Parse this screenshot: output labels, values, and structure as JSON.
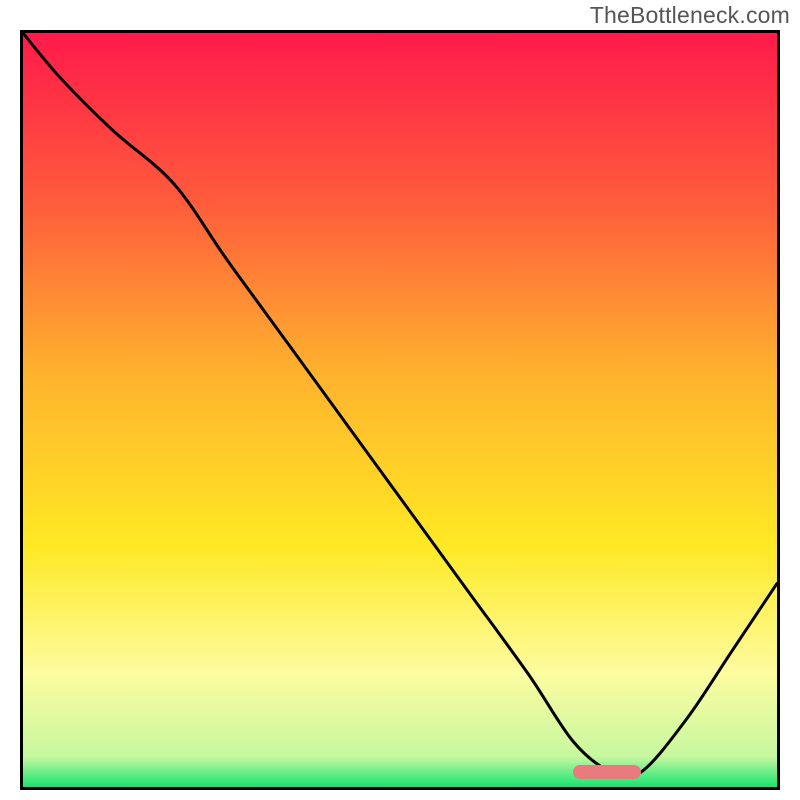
{
  "watermark": "TheBottleneck.com",
  "colors": {
    "gradient_stops": [
      {
        "offset": "0%",
        "color": "#ff1a4a"
      },
      {
        "offset": "22%",
        "color": "#ff5a3c"
      },
      {
        "offset": "45%",
        "color": "#ffb22e"
      },
      {
        "offset": "68%",
        "color": "#ffe924"
      },
      {
        "offset": "85%",
        "color": "#fdfca0"
      },
      {
        "offset": "96%",
        "color": "#c7f8a0"
      },
      {
        "offset": "100%",
        "color": "#17e36f"
      }
    ],
    "curve": "#000000",
    "marker": "#e97a7e",
    "frame": "#000000"
  },
  "chart_data": {
    "type": "line",
    "title": "",
    "xlabel": "",
    "ylabel": "",
    "xlim": [
      0,
      100
    ],
    "ylim": [
      0,
      100
    ],
    "x": [
      0,
      5,
      12,
      20,
      27,
      35,
      43,
      51,
      59,
      67,
      73,
      78,
      82,
      88,
      94,
      100
    ],
    "values": [
      100,
      94,
      87,
      80,
      70,
      59,
      48,
      37,
      26,
      15,
      6,
      2,
      2,
      9,
      18,
      27
    ],
    "optimal_range_x": [
      73,
      82
    ],
    "marker_y": 2
  }
}
